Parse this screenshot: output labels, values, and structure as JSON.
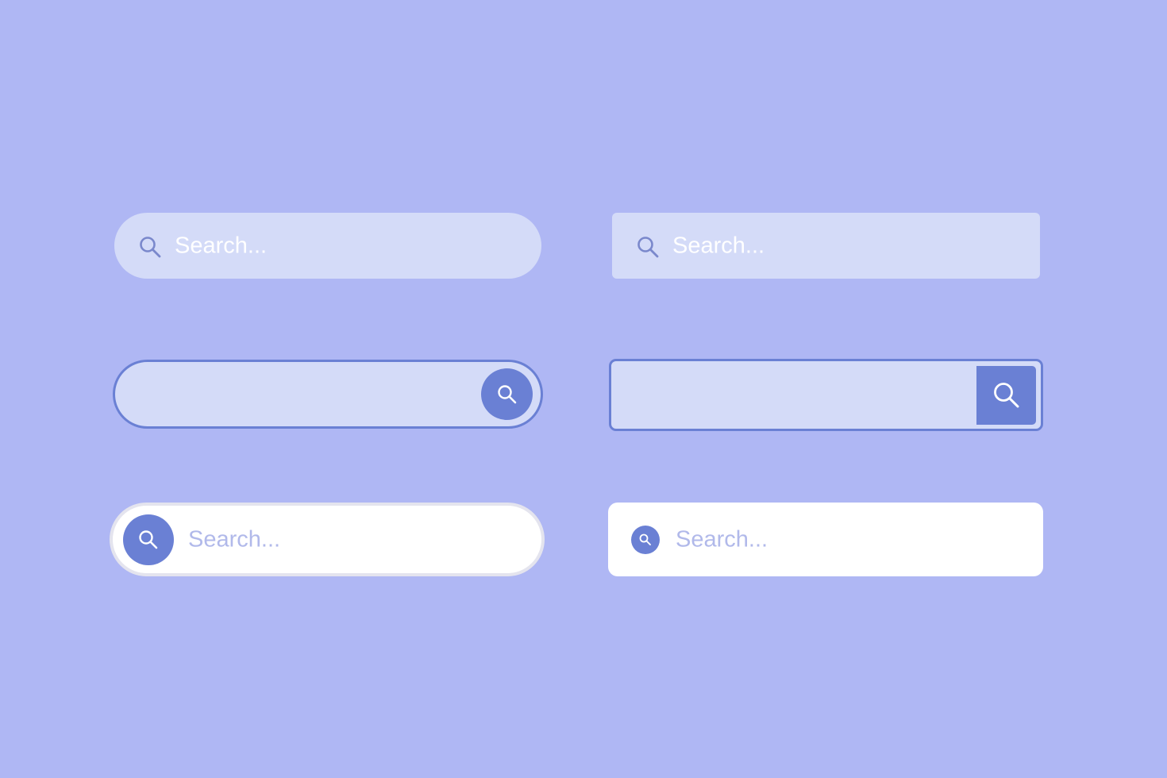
{
  "colors": {
    "background": "#afb7f4",
    "field_fill": "#d4dbf8",
    "accent": "#6a80d4",
    "white": "#ffffff"
  },
  "search_bars": [
    {
      "style": "pill-filled",
      "placeholder": "Search...",
      "icon": "search-icon"
    },
    {
      "style": "rect-filled",
      "placeholder": "Search...",
      "icon": "search-icon"
    },
    {
      "style": "pill-outlined-button-right",
      "placeholder": "",
      "icon": "search-icon"
    },
    {
      "style": "rect-outlined-button-right",
      "placeholder": "",
      "icon": "search-icon"
    },
    {
      "style": "pill-white-button-left",
      "placeholder": "Search...",
      "icon": "search-icon"
    },
    {
      "style": "rect-white-icon-left",
      "placeholder": "Search...",
      "icon": "search-icon"
    }
  ]
}
